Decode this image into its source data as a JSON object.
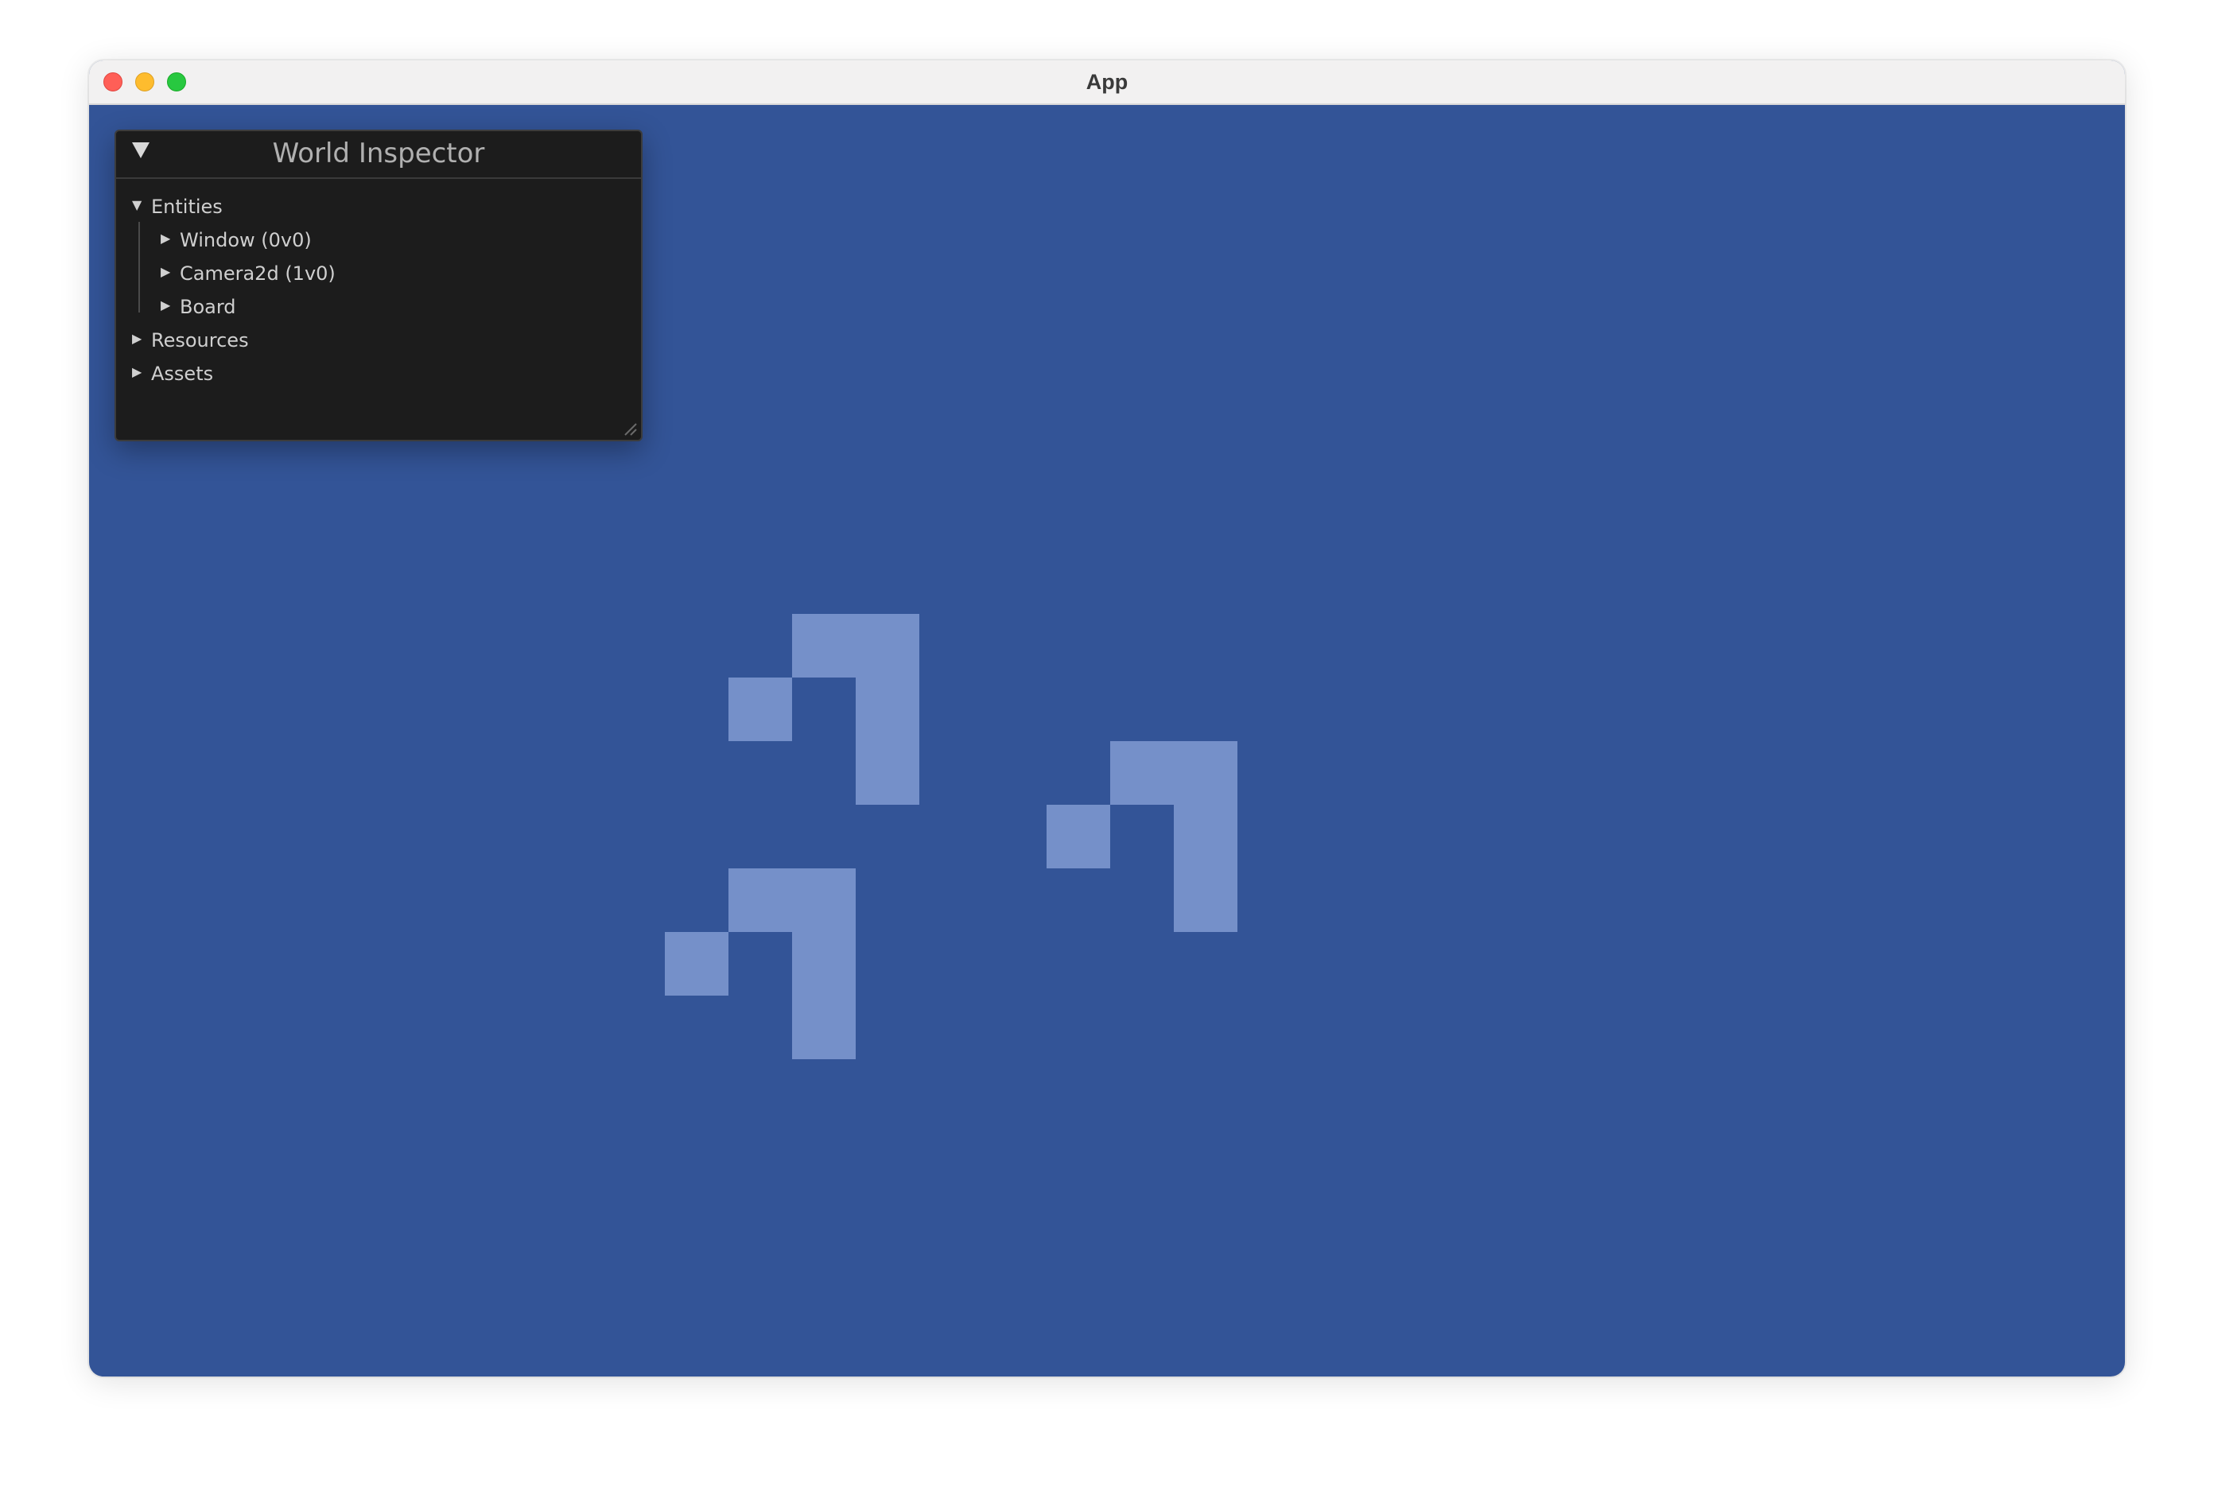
{
  "window": {
    "title": "App"
  },
  "inspector": {
    "title": "World Inspector",
    "collapse_icon": "triangle-down-icon",
    "tree": {
      "entities": {
        "label": "Entities",
        "expanded": true,
        "children": [
          {
            "label": "Window (0v0)",
            "expanded": false
          },
          {
            "label": "Camera2d (1v0)",
            "expanded": false
          },
          {
            "label": "Board",
            "expanded": false
          }
        ]
      },
      "resources": {
        "label": "Resources",
        "expanded": false
      },
      "assets": {
        "label": "Assets",
        "expanded": false
      }
    }
  },
  "board": {
    "background_color": "#335497",
    "live_cell_color": "#7590c9",
    "gliders": 3,
    "cells_per_glider": 5
  },
  "colors": {
    "titlebar": "#f2f1f1",
    "close": "#ff5f57",
    "minimize": "#febc2e",
    "zoom": "#28c840",
    "inspector_bg": "#1c1c1c"
  }
}
